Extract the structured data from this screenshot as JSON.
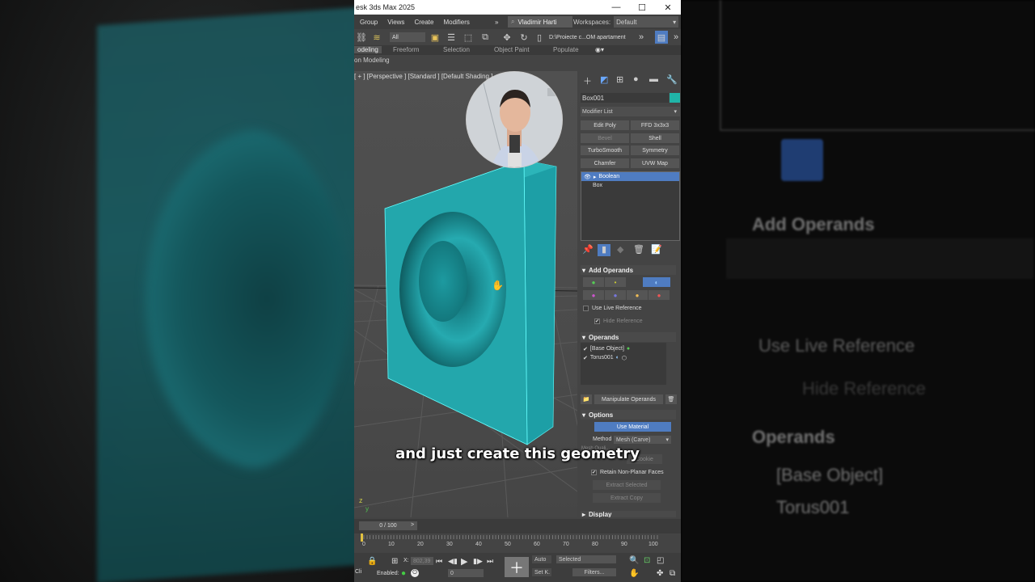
{
  "window": {
    "title": "esk 3ds Max 2025",
    "minimize": "—",
    "maximize": "☐",
    "close": "✕"
  },
  "menu": {
    "items": [
      "Group",
      "Views",
      "Create",
      "Modifiers"
    ],
    "more": "»",
    "user": "Vladimir Harti",
    "workspaces_label": "Workspaces:",
    "workspace_value": "Default"
  },
  "toolbar": {
    "filter_value": "All",
    "project_path": "D:\\Proiecte c...OM apartament"
  },
  "ribbon": {
    "tabs": [
      "odeling",
      "Freeform",
      "Selection",
      "Object Paint",
      "Populate"
    ],
    "sub": "on Modeling"
  },
  "viewport": {
    "label": "[ + ] [Perspective ] [Standard ] [Default Shading ]"
  },
  "colors": {
    "object_color": "#20b5a8",
    "selection_blue": "#4f7cc1",
    "teal": "#1e9aa0"
  },
  "panel": {
    "object_name": "Box001",
    "modifier_list_label": "Modifier List",
    "modifier_buttons": [
      "Edit Poly",
      "FFD 3x3x3",
      "Bevel",
      "Shell",
      "TurboSmooth",
      "Symmetry",
      "Chamfer",
      "UVW Map"
    ],
    "stack_items": [
      "Boolean",
      "Box"
    ],
    "add_operands_title": "Add Operands",
    "use_live_reference": "Use Live Reference",
    "hide_reference": "Hide Reference",
    "operands_title": "Operands",
    "operands": [
      "[Base Object]",
      "Torus001"
    ],
    "manipulate_operands": "Manipulate Operands",
    "options_title": "Options",
    "use_material": "Use Material",
    "method_label": "Method",
    "method_value": "Mesh (Carve)",
    "mesh_quality": "Mesh Quali...",
    "cookie": "Cookie",
    "retain_non_planar": "Retain Non-Planar Faces",
    "extract_selected": "Extract Selected",
    "extract_copy": "Extract Copy",
    "display_title": "Display"
  },
  "timeline": {
    "frame_slider": "0 / 100",
    "next": ">",
    "ticks": [
      "0",
      "10",
      "20",
      "30",
      "40",
      "50",
      "60",
      "70",
      "80",
      "90",
      "100"
    ]
  },
  "status": {
    "x_label": "X:",
    "x_value": "802,39",
    "enabled_label": "Enabled:",
    "frame_value": "0",
    "auto": "Auto",
    "set_key": "Set K.",
    "selected": "Selected",
    "filters": "Filters..."
  },
  "caption": "and just create this geometry"
}
